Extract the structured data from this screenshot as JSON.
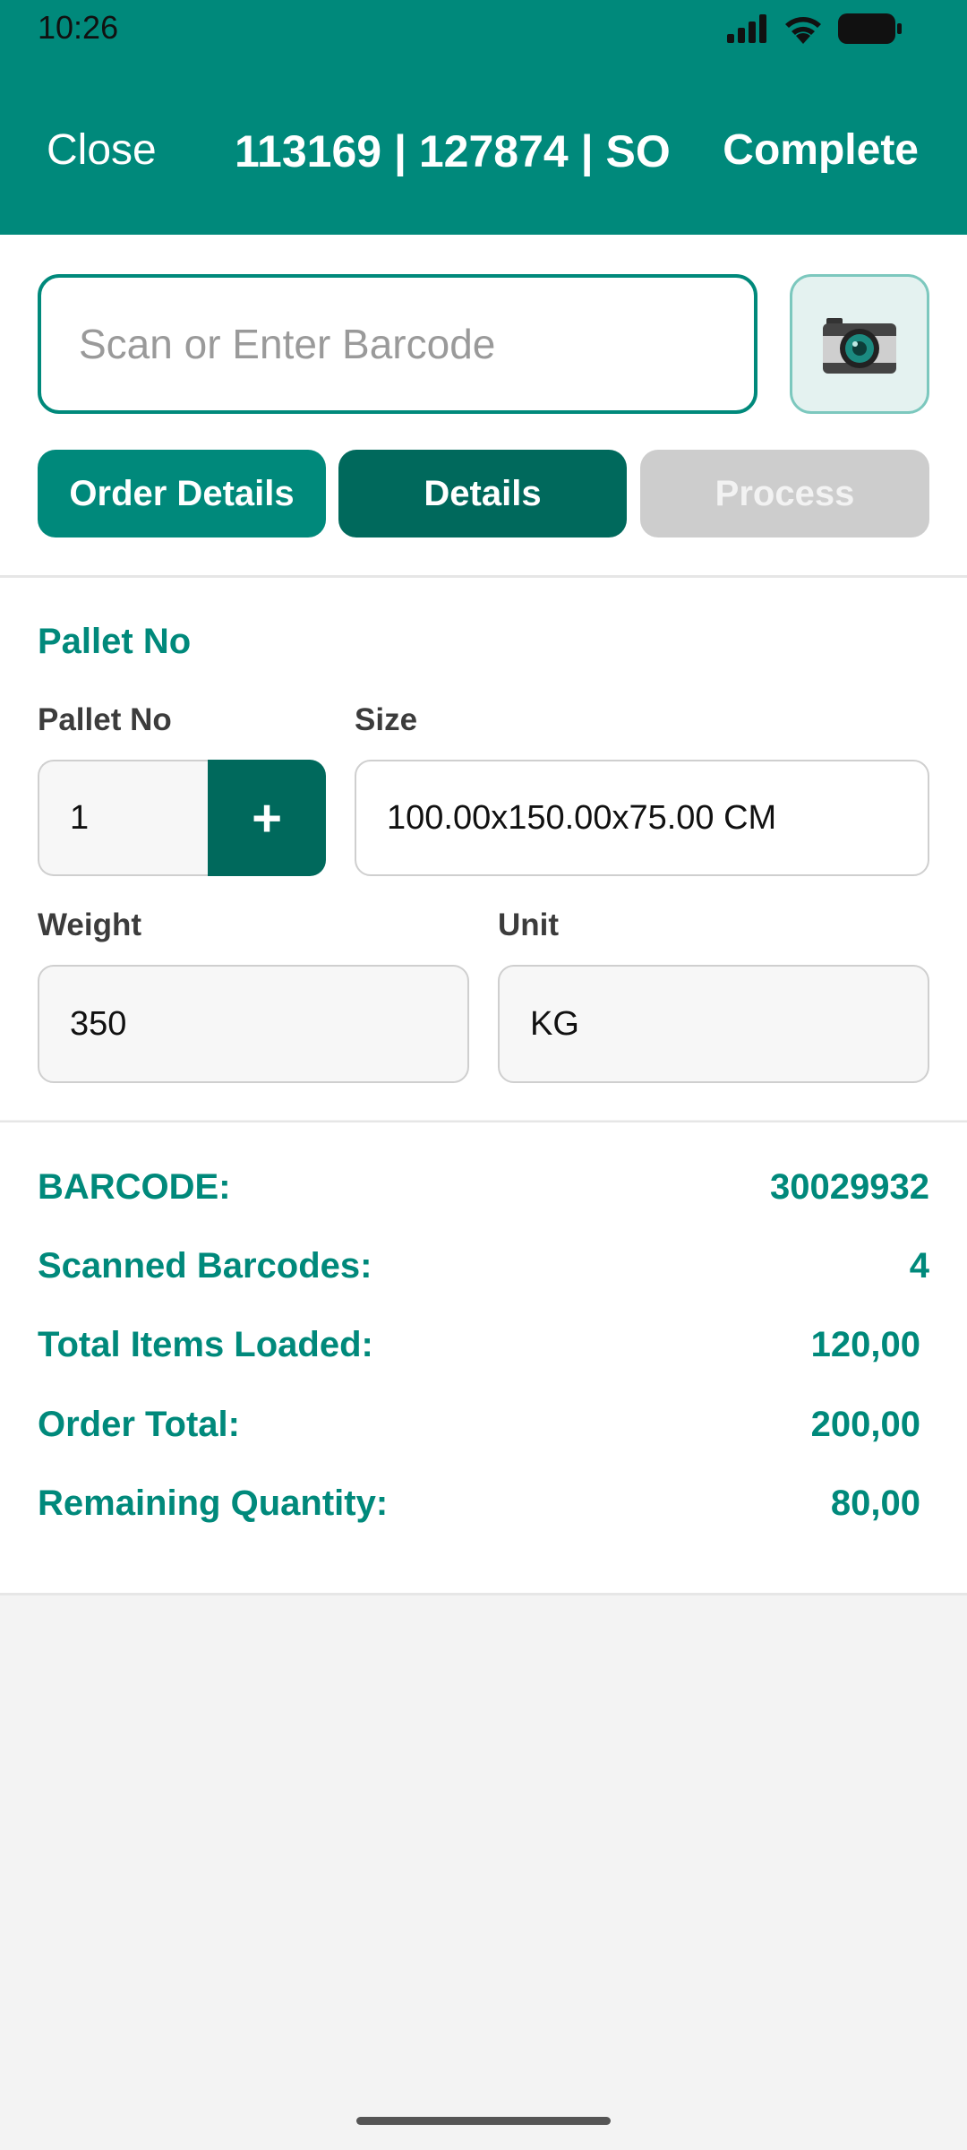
{
  "status_bar": {
    "time": "10:26"
  },
  "header": {
    "close_label": "Close",
    "title": "113169 | 127874 | SO",
    "complete_label": "Complete"
  },
  "search": {
    "placeholder": "Scan or Enter Barcode",
    "value": ""
  },
  "tabs": [
    {
      "label": "Order Details",
      "state": "normal"
    },
    {
      "label": "Details",
      "state": "active"
    },
    {
      "label": "Process",
      "state": "disabled"
    }
  ],
  "pallet": {
    "section_title": "Pallet No",
    "pallet_no_label": "Pallet No",
    "pallet_no_value": "1",
    "plus_label": "+",
    "size_label": "Size",
    "size_value": "100.00x150.00x75.00 CM",
    "weight_label": "Weight",
    "weight_value": "350",
    "unit_label": "Unit",
    "unit_value": "KG"
  },
  "summary": [
    {
      "label": "BARCODE:",
      "value": "30029932"
    },
    {
      "label": "Scanned Barcodes:",
      "value": "4"
    },
    {
      "label": "Total Items Loaded:",
      "value": "120,00"
    },
    {
      "label": "Order Total:",
      "value": "200,00"
    },
    {
      "label": "Remaining Quantity:",
      "value": "80,00"
    }
  ],
  "colors": {
    "primary": "#00897b",
    "primary_dark": "#00695c",
    "disabled": "#cdcdcd",
    "background": "#f3f3f3"
  },
  "icons": [
    "signal-icon",
    "wifi-icon",
    "battery-icon",
    "camera-icon"
  ]
}
